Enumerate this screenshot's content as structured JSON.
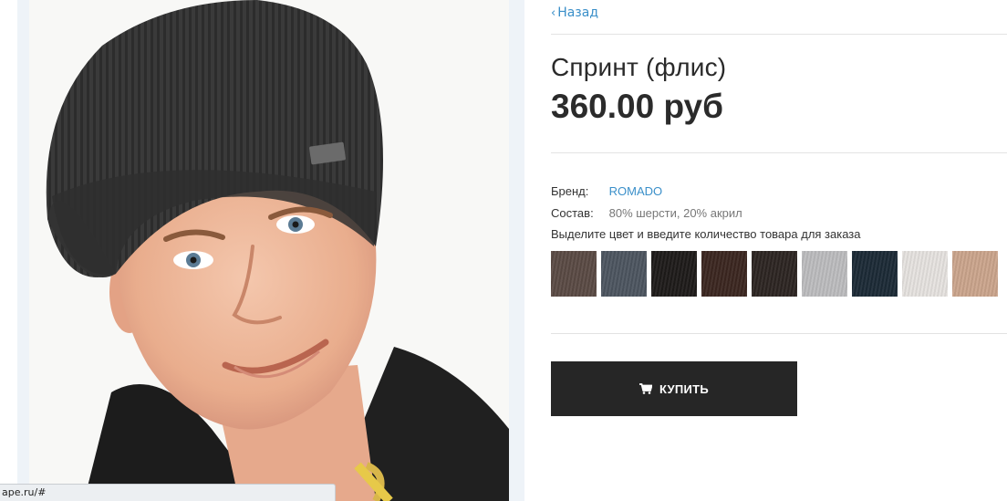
{
  "product": {
    "back_label": "Назад",
    "title": "Спринт (флис)",
    "price": "360.00 руб",
    "brand_label": "Бренд:",
    "brand_value": "ROMADO",
    "composition_label": "Состав:",
    "composition_value": "80% шерсти, 20% акрил",
    "color_hint": "Выделите цвет и введите количество товара для заказа",
    "buy_label": "КУПИТЬ",
    "swatches": [
      {
        "name": "brown-gray",
        "color": "#5a4a44"
      },
      {
        "name": "slate-gray",
        "color": "#4d5560"
      },
      {
        "name": "black",
        "color": "#1e1b1a"
      },
      {
        "name": "dark-brown",
        "color": "#3b2620"
      },
      {
        "name": "charcoal-brown",
        "color": "#2d2522"
      },
      {
        "name": "light-gray",
        "color": "#bcbcbe"
      },
      {
        "name": "navy",
        "color": "#1c2a36"
      },
      {
        "name": "off-white",
        "color": "#e6e2df"
      },
      {
        "name": "beige",
        "color": "#cba58c"
      }
    ]
  },
  "status_bar": {
    "url": "ape.ru/#"
  },
  "colors": {
    "link": "#3a8fc9",
    "button_bg": "#262626"
  }
}
